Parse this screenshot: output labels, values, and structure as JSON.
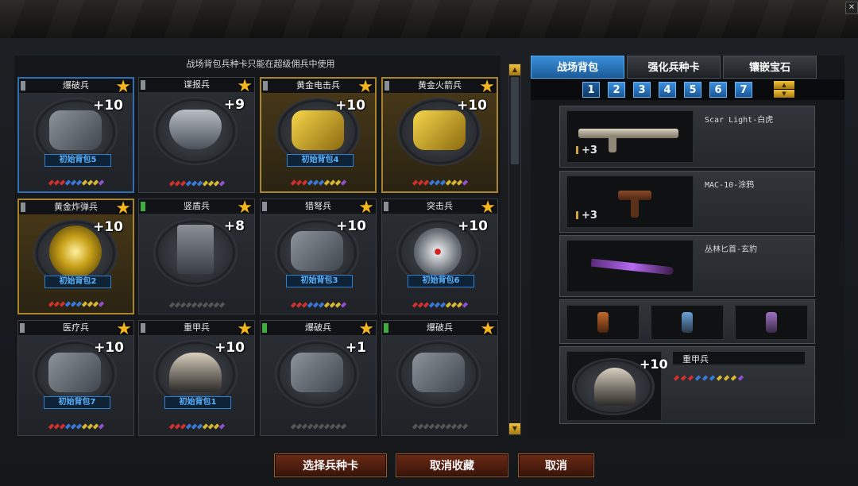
{
  "notice": "战场背包兵种卡只能在超级佣兵中使用",
  "cards": [
    {
      "name": "爆破兵",
      "plus": "+10",
      "pack": "初始背包5",
      "ind": "gray",
      "border": "blue",
      "item": "bag",
      "gems": [
        "#d03030",
        "#d03030",
        "#d03030",
        "#3a78d8",
        "#3a78d8",
        "#3a78d8",
        "#d8b830",
        "#d8b830",
        "#d8b830",
        "#9050d0"
      ]
    },
    {
      "name": "谍报兵",
      "plus": "+9",
      "pack": "",
      "ind": "gray",
      "border": "normal",
      "item": "mask",
      "gems": [
        "#d03030",
        "#d03030",
        "#d03030",
        "#3a78d8",
        "#3a78d8",
        "#3a78d8",
        "#d8b830",
        "#d8b830",
        "#d8b830",
        "#9050d0"
      ]
    },
    {
      "name": "黄金电击兵",
      "plus": "+10",
      "pack": "初始背包4",
      "ind": "gray",
      "border": "gold",
      "item": "gold",
      "gems": [
        "#d03030",
        "#d03030",
        "#d03030",
        "#3a78d8",
        "#3a78d8",
        "#3a78d8",
        "#d8b830",
        "#d8b830",
        "#d8b830",
        "#9050d0"
      ]
    },
    {
      "name": "黄金火箭兵",
      "plus": "+10",
      "pack": "",
      "ind": "gray",
      "border": "gold",
      "item": "gold",
      "gems": [
        "#d03030",
        "#d03030",
        "#d03030",
        "#3a78d8",
        "#3a78d8",
        "#3a78d8",
        "#d8b830",
        "#d8b830",
        "#d8b830",
        "#9050d0"
      ]
    },
    {
      "name": "黄金炸弹兵",
      "plus": "+10",
      "pack": "初始背包2",
      "ind": "gray",
      "border": "gold",
      "item": "goldround",
      "gems": [
        "#d03030",
        "#d03030",
        "#d03030",
        "#3a78d8",
        "#3a78d8",
        "#3a78d8",
        "#d8b830",
        "#d8b830",
        "#d8b830",
        "#9050d0"
      ]
    },
    {
      "name": "竖盾兵",
      "plus": "+8",
      "pack": "",
      "ind": "green",
      "border": "normal",
      "item": "shield",
      "gems": [
        "#555",
        "#555",
        "#555",
        "#555",
        "#555",
        "#555",
        "#555",
        "#555",
        "#555",
        "#555"
      ]
    },
    {
      "name": "猎弩兵",
      "plus": "+10",
      "pack": "初始背包3",
      "ind": "gray",
      "border": "normal",
      "item": "bag",
      "gems": [
        "#d03030",
        "#d03030",
        "#d03030",
        "#3a78d8",
        "#3a78d8",
        "#3a78d8",
        "#d8b830",
        "#d8b830",
        "#d8b830",
        "#9050d0"
      ]
    },
    {
      "name": "突击兵",
      "plus": "+10",
      "pack": "初始背包6",
      "ind": "gray",
      "border": "normal",
      "item": "round",
      "gems": [
        "#d03030",
        "#d03030",
        "#d03030",
        "#3a78d8",
        "#3a78d8",
        "#3a78d8",
        "#d8b830",
        "#d8b830",
        "#d8b830",
        "#9050d0"
      ]
    },
    {
      "name": "医疗兵",
      "plus": "+10",
      "pack": "初始背包7",
      "ind": "gray",
      "border": "normal",
      "item": "bag",
      "gems": [
        "#d03030",
        "#d03030",
        "#d03030",
        "#3a78d8",
        "#3a78d8",
        "#3a78d8",
        "#d8b830",
        "#d8b830",
        "#d8b830",
        "#9050d0"
      ]
    },
    {
      "name": "重甲兵",
      "plus": "+10",
      "pack": "初始背包1",
      "ind": "gray",
      "border": "normal",
      "item": "helmet",
      "gems": [
        "#d03030",
        "#d03030",
        "#d03030",
        "#3a78d8",
        "#3a78d8",
        "#3a78d8",
        "#d8b830",
        "#d8b830",
        "#d8b830",
        "#9050d0"
      ]
    },
    {
      "name": "爆破兵",
      "plus": "+1",
      "pack": "",
      "ind": "green",
      "border": "normal",
      "item": "bag",
      "gems": [
        "#555",
        "#555",
        "#555",
        "#555",
        "#555",
        "#555",
        "#555",
        "#555",
        "#555",
        "#555"
      ]
    },
    {
      "name": "爆破兵",
      "plus": "",
      "pack": "",
      "ind": "green",
      "border": "normal",
      "item": "bag",
      "gems": [
        "#555",
        "#555",
        "#555",
        "#555",
        "#555",
        "#555",
        "#555",
        "#555",
        "#555",
        "#555"
      ]
    }
  ],
  "tabs": [
    "战场背包",
    "强化兵种卡",
    "镶嵌宝石"
  ],
  "pages": [
    "1",
    "2",
    "3",
    "4",
    "5",
    "6",
    "7"
  ],
  "slots": [
    {
      "name": "Scar Light-白虎",
      "plus": "+3"
    },
    {
      "name": "MAC-10-涂鸦",
      "plus": "+3"
    },
    {
      "name": "丛林匕首-玄豹",
      "plus": ""
    }
  ],
  "unit": {
    "name": "重甲兵",
    "plus": "+10",
    "gems": [
      "#d03030",
      "#d03030",
      "#d03030",
      "#3a78d8",
      "#3a78d8",
      "#3a78d8",
      "#d8b830",
      "#d8b830",
      "#d8b830",
      "#9050d0"
    ]
  },
  "buttons": {
    "select": "选择兵种卡",
    "cancel_fav": "取消收藏",
    "cancel": "取消"
  },
  "colors": {
    "active_tab": "#2f7fd0",
    "gold_border": "#a8842b",
    "star": "#f5b51c",
    "button": "#6a2a14"
  }
}
